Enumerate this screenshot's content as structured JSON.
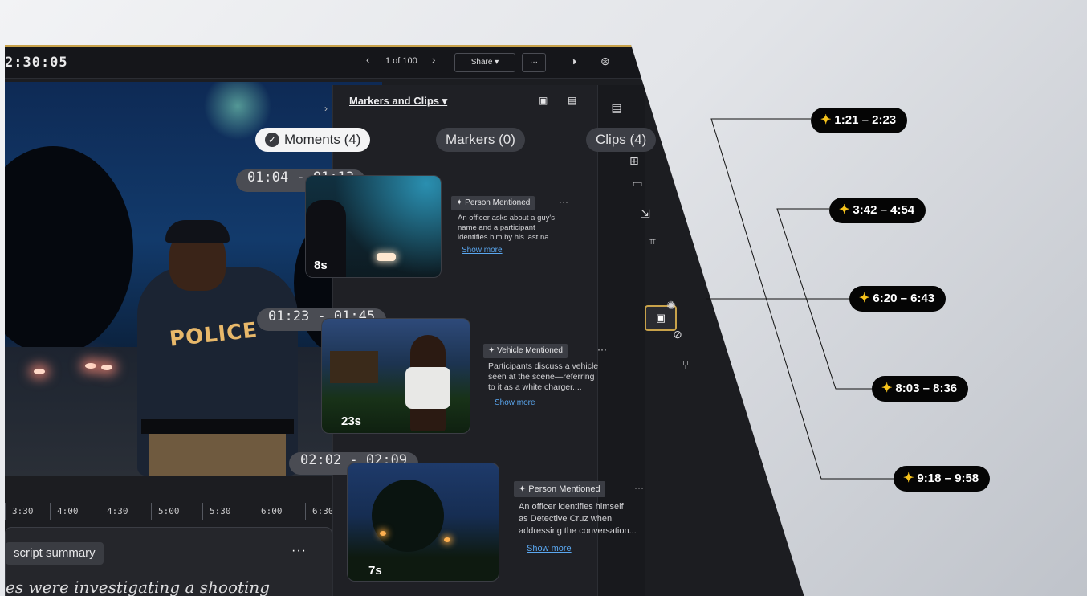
{
  "topbar": {
    "timestamp": "2:30:05",
    "prev": "‹",
    "pager": "1 of 100",
    "next": "›",
    "share": "Share ▾",
    "more": "···"
  },
  "panel": {
    "title": "Markers and Clips",
    "title_caret": "▾"
  },
  "filters": {
    "moments": "Moments (4)",
    "markers": "Markers (0)",
    "clips": "Clips (4)"
  },
  "moments": [
    {
      "range": "01:04 - 01:12",
      "duration": "8s",
      "tag": "Person Mentioned",
      "desc": [
        "An officer asks about a guy's",
        "name and a participant",
        "identifies him by his last na..."
      ],
      "show_more": "Show more"
    },
    {
      "range": "01:23 - 01:45",
      "duration": "23s",
      "tag": "Vehicle Mentioned",
      "desc": [
        "Participants discuss a vehicle",
        "seen at the scene—referring",
        "to it as a white charger...."
      ],
      "show_more": "Show more"
    },
    {
      "range": "02:02 - 02:09",
      "duration": "7s",
      "tag": "Person Mentioned",
      "desc": [
        "An officer identifies himself",
        "as Detective Cruz when",
        "addressing the conversation..."
      ],
      "show_more": "Show more"
    }
  ],
  "video": {
    "jacket_text": "POLICE"
  },
  "timeline": {
    "ticks": [
      "3:30",
      "4:00",
      "4:30",
      "5:00",
      "5:30",
      "6:00",
      "6:30"
    ]
  },
  "transcript": {
    "chip": "script summary",
    "more": "···",
    "text": "es were investigating a shooting"
  },
  "callouts": [
    "1:21 – 2:23",
    "3:42 – 4:54",
    "6:20 – 6:43",
    "8:03 – 8:36",
    "9:18 – 9:58"
  ],
  "colors": {
    "accent_gold": "#c8a24a",
    "spark": "#f6c31b",
    "link": "#5aa7f0"
  }
}
